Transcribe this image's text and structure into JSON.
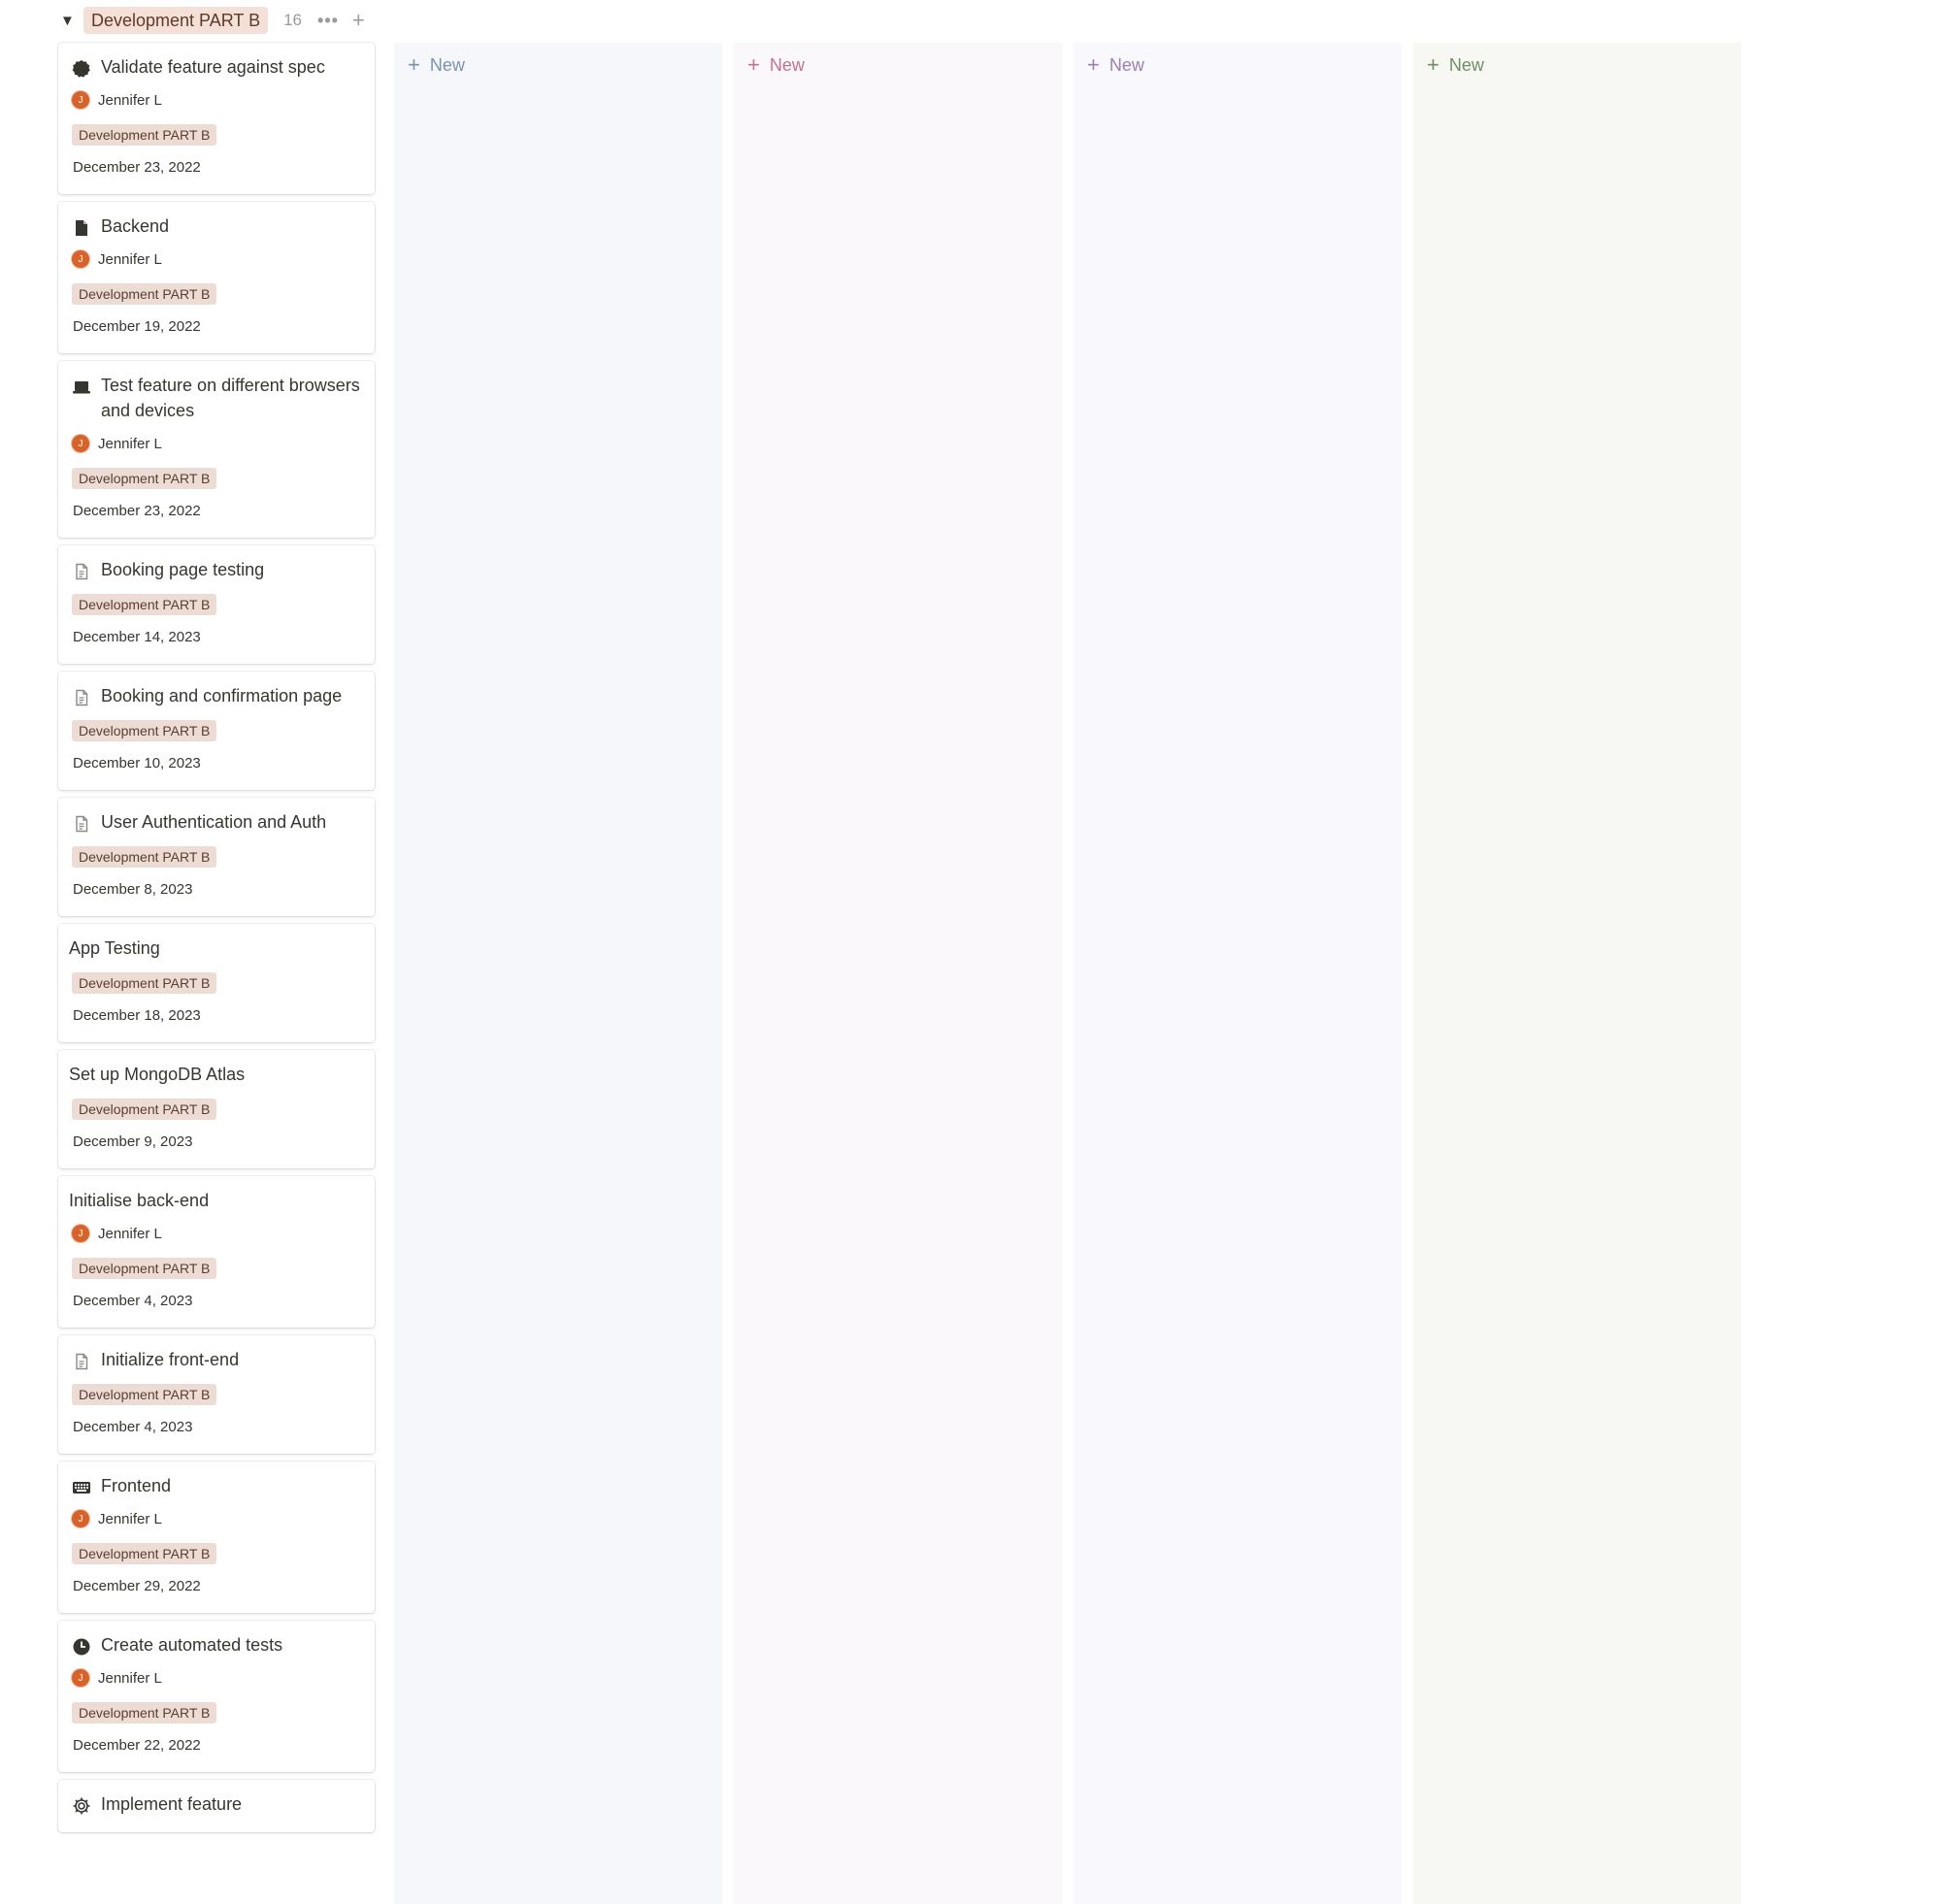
{
  "group": {
    "name": "Development PART B",
    "count": "16",
    "more_label": "•••",
    "add_label": "+"
  },
  "colors": {
    "accent_tag": "#eddcd4",
    "avatar": "#d9622b",
    "col_new": [
      "#7892b0",
      "#c4718f",
      "#9a7fb5",
      "#6f8f63"
    ]
  },
  "columns": [
    {
      "new_label": "New"
    },
    {
      "new_label": "New"
    },
    {
      "new_label": "New"
    },
    {
      "new_label": "New"
    }
  ],
  "cards": [
    {
      "title": "Validate feature against spec",
      "icon": "badge-icon",
      "assignee": "Jennifer L",
      "avatar_letter": "J",
      "tag": "Development PART B",
      "date": "December 23, 2022"
    },
    {
      "title": "Backend",
      "icon": "file-icon",
      "assignee": "Jennifer L",
      "avatar_letter": "J",
      "tag": "Development PART B",
      "date": "December 19, 2022"
    },
    {
      "title": "Test feature on different browsers and devices",
      "icon": "laptop-icon",
      "assignee": "Jennifer L",
      "avatar_letter": "J",
      "tag": "Development PART B",
      "date": "December 23, 2022"
    },
    {
      "title": "Booking page testing",
      "icon": "document-icon",
      "tag": "Development PART B",
      "date": "December 14, 2023"
    },
    {
      "title": "Booking and confirmation page",
      "icon": "document-icon",
      "tag": "Development PART B",
      "date": "December 10, 2023"
    },
    {
      "title": "User Authentication and Auth",
      "icon": "document-icon",
      "tag": "Development PART B",
      "date": "December 8, 2023"
    },
    {
      "title": "App Testing",
      "tag": "Development PART B",
      "date": "December 18, 2023"
    },
    {
      "title": "Set up MongoDB Atlas",
      "tag": "Development PART B",
      "date": "December 9, 2023"
    },
    {
      "title": "Initialise back-end",
      "assignee": "Jennifer L",
      "avatar_letter": "J",
      "tag": "Development PART B",
      "date": "December 4, 2023"
    },
    {
      "title": "Initialize front-end",
      "icon": "document-icon",
      "tag": "Development PART B",
      "date": "December 4, 2023"
    },
    {
      "title": "Frontend",
      "icon": "keyboard-icon",
      "assignee": "Jennifer L",
      "avatar_letter": "J",
      "tag": "Development PART B",
      "date": "December 29, 2022"
    },
    {
      "title": "Create automated tests",
      "icon": "clock-icon",
      "assignee": "Jennifer L",
      "avatar_letter": "J",
      "tag": "Development PART B",
      "date": "December 22, 2022"
    },
    {
      "title": "Implement feature",
      "icon": "gear-icon"
    }
  ]
}
